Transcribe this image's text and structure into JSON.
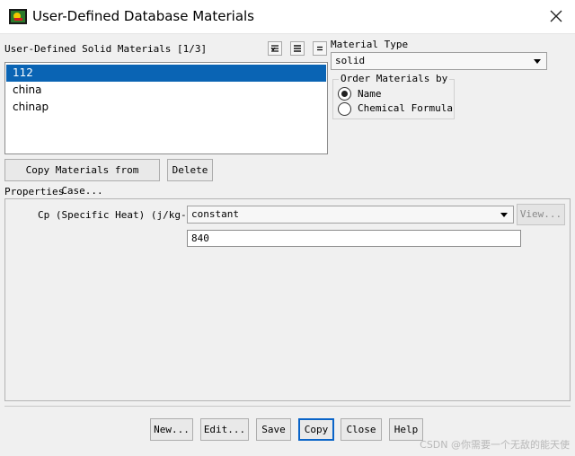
{
  "window": {
    "title": "User-Defined Database Materials",
    "icon": "fluent-app-icon",
    "close_icon": "close-icon"
  },
  "materials": {
    "header": "User-Defined Solid Materials [1/3]",
    "items": [
      "112",
      "china",
      "chinap"
    ],
    "selected_index": 0,
    "toolbar_icons": [
      "select-all-icon",
      "list-icon",
      "deselect-icon"
    ]
  },
  "material_type": {
    "label": "Material Type",
    "value": "solid"
  },
  "order": {
    "label": "Order Materials by",
    "options": [
      "Name",
      "Chemical Formula"
    ],
    "selected": "Name"
  },
  "actions": {
    "copy_from_case": "Copy Materials from Case...",
    "delete": "Delete"
  },
  "properties": {
    "label": "Properties",
    "cp_label": "Cp (Specific Heat) (j/kg-k)",
    "cp_method": "constant",
    "view_button": "View...",
    "cp_value": "840"
  },
  "buttons": {
    "new": "New...",
    "edit": "Edit...",
    "save": "Save",
    "copy": "Copy",
    "close": "Close",
    "help": "Help"
  },
  "watermark": "CSDN @你需要一个无敌的能天使"
}
